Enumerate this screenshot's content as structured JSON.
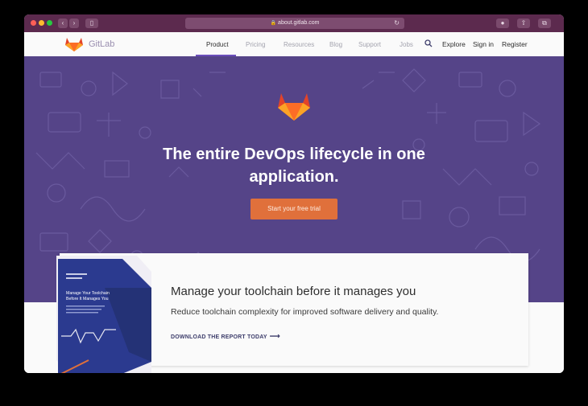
{
  "browser": {
    "url": "about.gitlab.com",
    "back_icon": "chevron-left-icon",
    "forward_icon": "chevron-right-icon"
  },
  "nav": {
    "brand": "GitLab",
    "links": [
      "Product",
      "Pricing",
      "Resources",
      "Blog",
      "Support",
      "Jobs"
    ],
    "active": "Product",
    "right_links": [
      "Explore",
      "Sign in",
      "Register"
    ]
  },
  "hero": {
    "title_line1": "The entire DevOps lifecycle in one",
    "title_line2": "application.",
    "cta_label": "Start your free trial",
    "background_color": "#554488",
    "cta_color": "#e0703b"
  },
  "promo": {
    "title": "Manage your toolchain before it manages you",
    "subtitle": "Reduce toolchain complexity for improved software delivery and quality.",
    "link_label": "DOWNLOAD THE REPORT TODAY",
    "book_title": "Manage Your Toolchain Before It Manages You"
  },
  "colors": {
    "chrome": "#5c2a4e",
    "accent": "#6b4fbb",
    "gitlab_orange": "#e0703b"
  }
}
